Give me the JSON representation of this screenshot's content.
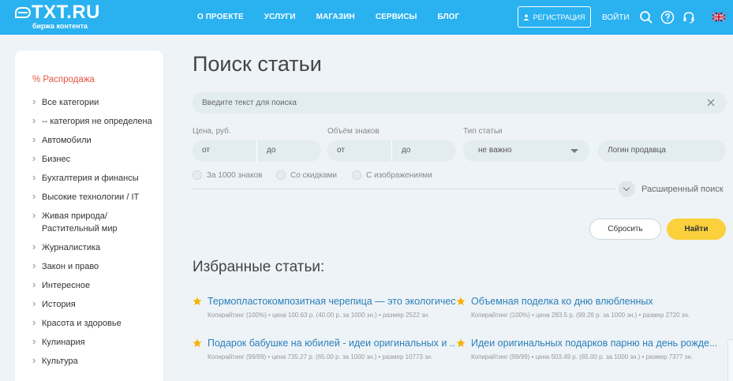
{
  "header": {
    "logo": "TXT.RU",
    "logo_sub": "биржа контента",
    "nav": [
      "О ПРОЕКТЕ",
      "УСЛУГИ",
      "МАГАЗИН",
      "СЕРВИСЫ",
      "БЛОГ"
    ],
    "register_label": "РЕГИСТРАЦИЯ",
    "login_label": "ВОЙТИ",
    "icons": [
      "search-icon",
      "help-icon",
      "support-headset-icon",
      "uk-flag-icon"
    ],
    "colors": {
      "bar": "#29b1f0"
    }
  },
  "sidebar": {
    "sale_label": "% Распродажа",
    "categories": [
      "Все категории",
      "-- категория не определена",
      "Автомобили",
      "Бизнес",
      "Бухгалтерия и финансы",
      "Высокие технологии / IT",
      "Живая природа/ Растительный мир",
      "Журналистика",
      "Закон и право",
      "Интересное",
      "История",
      "Красота и здоровье",
      "Кулинария",
      "Культура"
    ]
  },
  "main": {
    "title": "Поиск статьи",
    "search_placeholder": "Введите текст для поиска",
    "price_label": "Цена, руб.",
    "price_from": "от",
    "price_to": "до",
    "volume_label": "Объём знаков",
    "volume_from": "от",
    "volume_to": "до",
    "type_label": "Тип статьи",
    "type_value": "не важно",
    "seller_placeholder": "Логин продавца",
    "checks": [
      "За 1000 знаков",
      "Со скидками",
      "С изображениями"
    ],
    "advanced_label": "Расширенный поиск",
    "reset_label": "Сбросить",
    "find_label": "Найти",
    "favorites_title": "Избранные статьи:",
    "articles": [
      {
        "title": "Термопластокомпозитная черепица — это экологичес...",
        "meta": "Копирайтинг (100%) • цена 100.63 р. (40.00 р. за 1000 зн.) • размер 2522 зн."
      },
      {
        "title": "Объемная поделка ко дню влюбленных",
        "meta": "Копирайтинг (100%) • цена 283.5 р. (99.26 р. за 1000 зн.) • размер 2720 зн."
      },
      {
        "title": "Подарок бабушке на юбилей - идеи оригинальных и ...",
        "meta": "Копирайтинг (99/99) • цена 735.27 р. (65.00 р. за 1000 зн.) • размер 10773 зн."
      },
      {
        "title": "Идеи оригинальных подарков парню на день рожде...",
        "meta": "Копирайтинг (99/99) • цена 503.49 р. (65.00 р. за 1000 зн.) • размер 7377 зн."
      }
    ],
    "colors": {
      "link": "#2a7fb8",
      "sale": "#e2573d",
      "accent_button": "#fbd03c",
      "star": "#f6b100"
    }
  }
}
